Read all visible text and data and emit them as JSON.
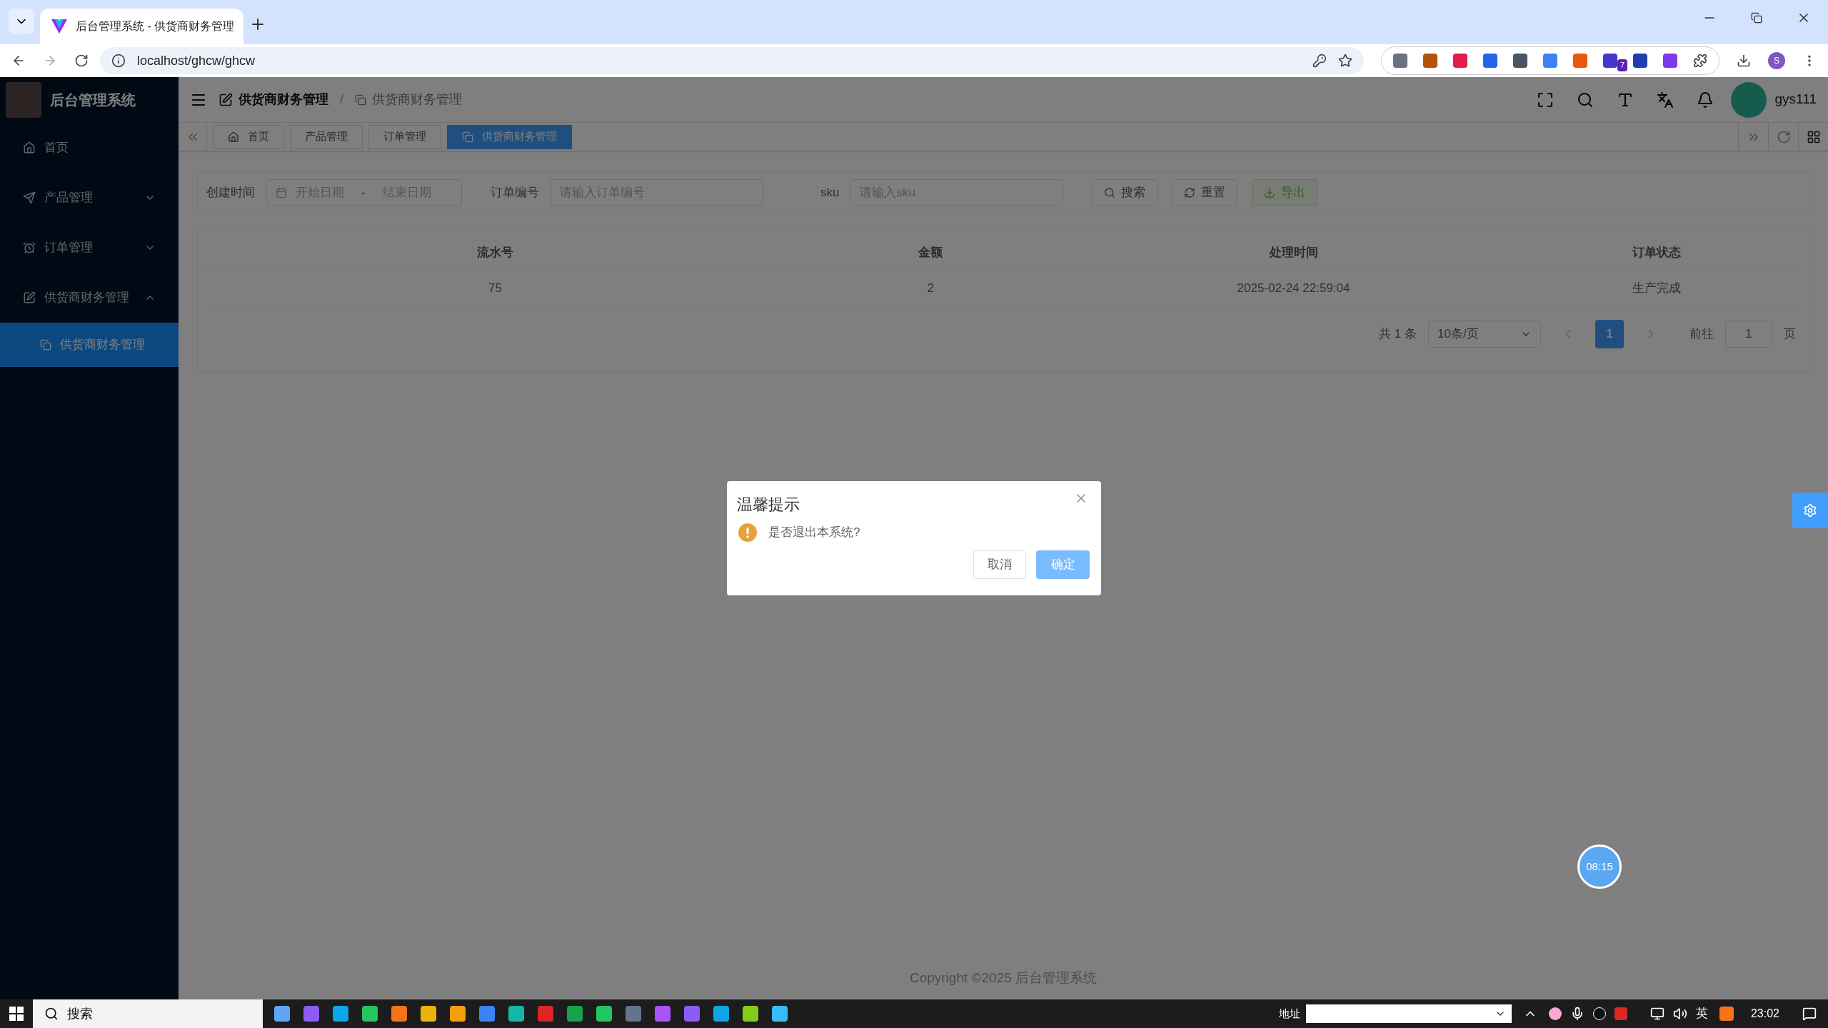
{
  "browser": {
    "tab_title": "后台管理系统 - 供货商财务管理",
    "url": "localhost/ghcw/ghcw",
    "profile": "S",
    "extension_badge": "7"
  },
  "app": {
    "title": "后台管理系统",
    "user": "gys111"
  },
  "breadcrumb": [
    "供货商财务管理",
    "供货商财务管理"
  ],
  "breadcrumb_separator": "/",
  "sidebar": {
    "items": [
      {
        "label": "首页",
        "kind": "link"
      },
      {
        "label": "产品管理",
        "kind": "group",
        "expanded": false
      },
      {
        "label": "订单管理",
        "kind": "group",
        "expanded": false
      },
      {
        "label": "供货商财务管理",
        "kind": "group",
        "expanded": true,
        "children": [
          {
            "label": "供货商财务管理",
            "selected": true
          }
        ]
      }
    ]
  },
  "tags": [
    {
      "label": "首页",
      "selected": false
    },
    {
      "label": "产品管理",
      "selected": false
    },
    {
      "label": "订单管理",
      "selected": false
    },
    {
      "label": "供货商财务管理",
      "selected": true
    }
  ],
  "filters": {
    "created_label": "创建时间",
    "start_placeholder": "开始日期",
    "separator": "-",
    "end_placeholder": "结束日期",
    "order_label": "订单编号",
    "order_placeholder": "请输入订单编号",
    "sku_label": "sku",
    "sku_placeholder": "请输入sku",
    "buttons": [
      {
        "label": "搜索",
        "kind": "search"
      },
      {
        "label": "重置",
        "kind": "reset"
      },
      {
        "label": "导出",
        "kind": "export"
      }
    ]
  },
  "table": {
    "columns": [
      "流水号",
      "金额",
      "处理时间",
      "订单状态"
    ],
    "rows": [
      [
        "75",
        "2",
        "2025-02-24 22:59:04",
        "生产完成"
      ]
    ]
  },
  "pagination": {
    "total": "共 1 条",
    "page_size": "10条/页",
    "pages": [
      {
        "label": "1",
        "selected": true
      }
    ],
    "goto_label": "前往",
    "goto_value": "1",
    "goto_suffix": "页"
  },
  "footer": "Copyright ©2025 后台管理系统",
  "floating_timer": "08:15",
  "dialog": {
    "title": "温馨提示",
    "message": "是否退出本系统?",
    "cancel": "取消",
    "confirm": "确定"
  },
  "taskbar": {
    "search": "搜索",
    "address_label": "地址",
    "ime": "英",
    "time": "23:02"
  }
}
